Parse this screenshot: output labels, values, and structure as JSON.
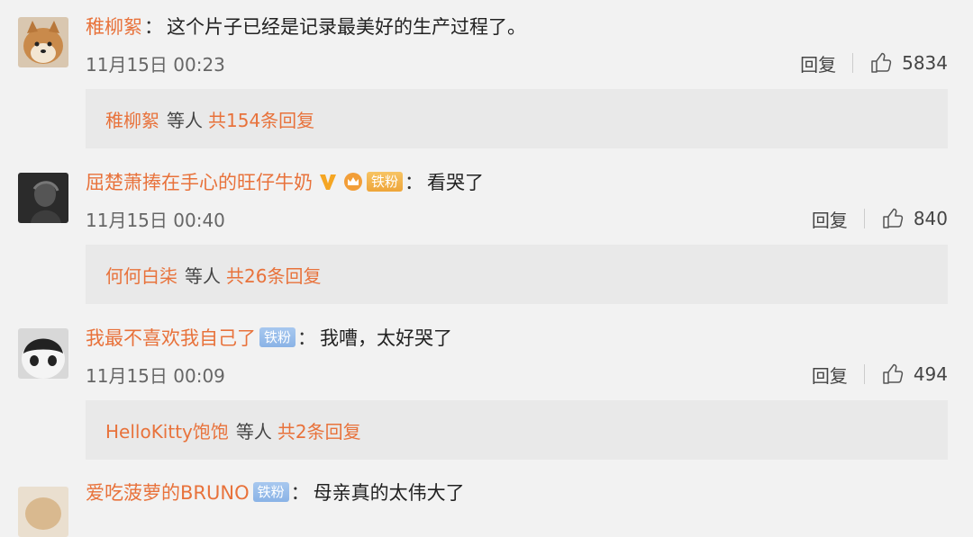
{
  "comments": [
    {
      "username": "稚柳絮",
      "colon": "：",
      "text": "这个片子已经是记录最美好的生产过程了。",
      "time": "11月15日 00:23",
      "reply_label": "回复",
      "likes": "5834",
      "reply_preview": {
        "user": "稚柳絮",
        "mid": "等人",
        "count": "共154条回复"
      }
    },
    {
      "username": "屈楚萧捧在手心的旺仔牛奶",
      "badge": "铁粉",
      "colon": "：",
      "text": "看哭了",
      "time": "11月15日 00:40",
      "reply_label": "回复",
      "likes": "840",
      "reply_preview": {
        "user": "何何白柒",
        "mid": "等人",
        "count": "共26条回复"
      }
    },
    {
      "username": "我最不喜欢我自己了",
      "badge": "铁粉",
      "colon": "：",
      "text": "我嘈，太好哭了",
      "time": "11月15日 00:09",
      "reply_label": "回复",
      "likes": "494",
      "reply_preview": {
        "user": "HelloKitty饱饱",
        "mid": "等人",
        "count": "共2条回复"
      }
    },
    {
      "username": "爱吃菠萝的BRUNO",
      "badge": "铁粉",
      "colon": "：",
      "text": "母亲真的太伟大了"
    }
  ],
  "colors": {
    "username": "#e8723b",
    "background": "#f2f2f2",
    "reply_box": "#e9e9e9",
    "badge_blue": "#8ab3e6"
  },
  "icons": [
    "avatar-shiba",
    "avatar-dark",
    "avatar-panda",
    "v-badge-icon",
    "crown-icon",
    "like-icon"
  ]
}
